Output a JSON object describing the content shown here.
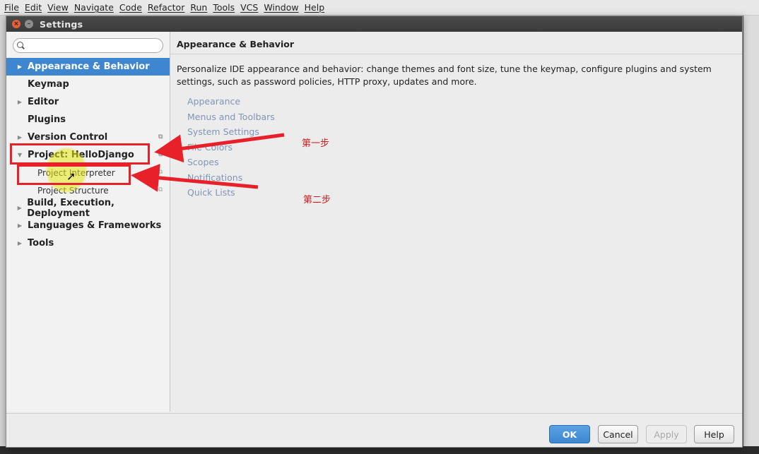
{
  "menubar": {
    "items": [
      "File",
      "Edit",
      "View",
      "Navigate",
      "Code",
      "Refactor",
      "Run",
      "Tools",
      "VCS",
      "Window",
      "Help"
    ]
  },
  "dialog": {
    "title": "Settings",
    "search": {
      "value": "",
      "placeholder": ""
    },
    "tree": [
      {
        "label": "Appearance & Behavior",
        "arrow": "right",
        "selected": true
      },
      {
        "label": "Keymap",
        "arrow": "none"
      },
      {
        "label": "Editor",
        "arrow": "right"
      },
      {
        "label": "Plugins",
        "arrow": "none"
      },
      {
        "label": "Version Control",
        "arrow": "right",
        "copy_icon": true
      },
      {
        "label": "Project: HelloDjango",
        "arrow": "down",
        "copy_icon": true
      },
      {
        "label": "Project Interpreter",
        "child": true,
        "copy_icon": true
      },
      {
        "label": "Project Structure",
        "child": true,
        "copy_icon": true
      },
      {
        "label": "Build, Execution, Deployment",
        "arrow": "right"
      },
      {
        "label": "Languages & Frameworks",
        "arrow": "right"
      },
      {
        "label": "Tools",
        "arrow": "right"
      }
    ],
    "breadcrumb": "Appearance & Behavior",
    "description": "Personalize IDE appearance and behavior: change themes and font size, tune the keymap, configure plugins and system settings, such as password policies, HTTP proxy, updates and more.",
    "links": [
      "Appearance",
      "Menus and Toolbars",
      "System Settings",
      "File Colors",
      "Scopes",
      "Notifications",
      "Quick Lists"
    ],
    "buttons": {
      "ok": "OK",
      "cancel": "Cancel",
      "apply": "Apply",
      "help": "Help"
    }
  },
  "annotations": {
    "step1": "第一步",
    "step2": "第二步"
  },
  "colors": {
    "accent": "#3e86cf",
    "annotation": "#e8202a",
    "link": "#8095b6"
  }
}
